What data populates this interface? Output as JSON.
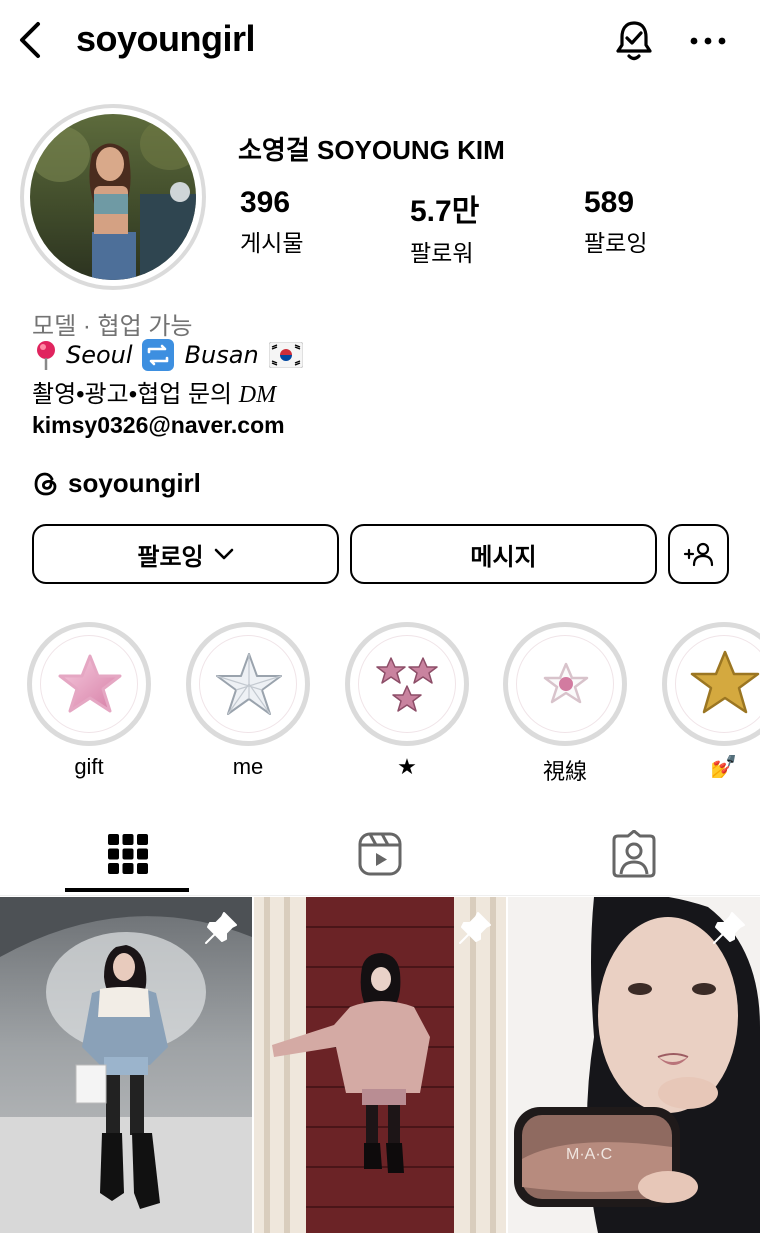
{
  "header": {
    "username": "soyoungirl",
    "icons": {
      "back": "back-arrow-icon",
      "notifications": "bell-check-icon",
      "more": "more-dots-icon"
    }
  },
  "profile": {
    "full_name": "소영걸 SOYOUNG KIM",
    "stats": [
      {
        "value": "396",
        "label": "게시물"
      },
      {
        "value": "5.7만",
        "label": "팔로워"
      },
      {
        "value": "589",
        "label": "팔로잉"
      }
    ],
    "bio": {
      "category": "모델 · 협업 가능",
      "location_from": "Seoul",
      "location_to": "Busan",
      "contact_line_text": "촬영•광고•협업 문의 ",
      "contact_line_dm": "DM",
      "email": "kimsy0326@naver.com"
    },
    "threads_handle": "soyoungirl"
  },
  "actions": {
    "following_label": "팔로잉",
    "message_label": "메시지"
  },
  "highlights": [
    {
      "label": "gift",
      "icon": "pink-puffy-star-icon"
    },
    {
      "label": "me",
      "icon": "crystal-star-icon"
    },
    {
      "label": "★",
      "icon": "three-pink-stars-icon"
    },
    {
      "label": "視線",
      "icon": "white-star-icon"
    },
    {
      "label": "💅",
      "icon": "gold-star-icon"
    }
  ],
  "tabs": [
    {
      "name": "grid",
      "icon": "grid-icon",
      "active": true
    },
    {
      "name": "reels",
      "icon": "reels-icon",
      "active": false
    },
    {
      "name": "tagged",
      "icon": "tagged-user-icon",
      "active": false
    }
  ],
  "posts": [
    {
      "pinned": true
    },
    {
      "pinned": true
    },
    {
      "pinned": true,
      "product_text": "M·A·C"
    }
  ],
  "colors": {
    "text": "#000000",
    "secondary": "#737373",
    "ring": "#dbdbdb"
  }
}
